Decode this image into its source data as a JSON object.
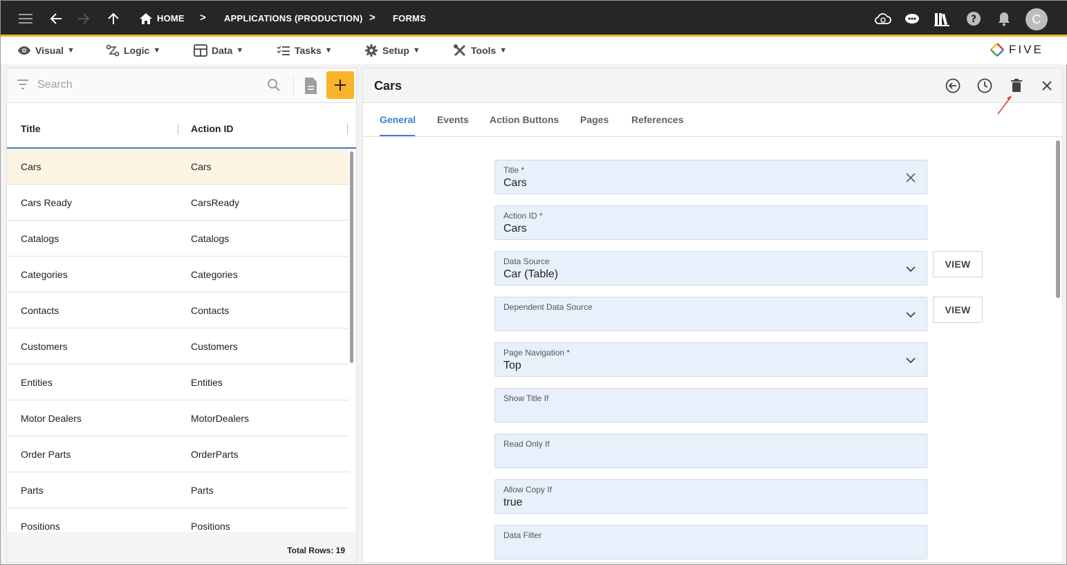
{
  "topbar": {
    "breadcrumbs": [
      "HOME",
      "APPLICATIONS (PRODUCTION)",
      "FORMS"
    ],
    "avatar_initial": "C",
    "icons": [
      "menu-icon",
      "back-arrow-icon",
      "forward-arrow-icon",
      "up-arrow-icon",
      "home-icon",
      "cloud-sync-icon",
      "chat-bot-icon",
      "library-icon",
      "help-icon",
      "bell-icon"
    ]
  },
  "menubar": {
    "items": [
      {
        "label": "Visual",
        "icon": "eye-icon"
      },
      {
        "label": "Logic",
        "icon": "logic-icon"
      },
      {
        "label": "Data",
        "icon": "table-icon"
      },
      {
        "label": "Tasks",
        "icon": "tasks-icon"
      },
      {
        "label": "Setup",
        "icon": "gear-icon"
      },
      {
        "label": "Tools",
        "icon": "tools-icon"
      }
    ],
    "logo_text": "FIVE"
  },
  "list": {
    "search_placeholder": "Search",
    "columns": [
      "Title",
      "Action ID"
    ],
    "rows": [
      {
        "title": "Cars",
        "action_id": "Cars"
      },
      {
        "title": "Cars Ready",
        "action_id": "CarsReady"
      },
      {
        "title": "Catalogs",
        "action_id": "Catalogs"
      },
      {
        "title": "Categories",
        "action_id": "Categories"
      },
      {
        "title": "Contacts",
        "action_id": "Contacts"
      },
      {
        "title": "Customers",
        "action_id": "Customers"
      },
      {
        "title": "Entities",
        "action_id": "Entities"
      },
      {
        "title": "Motor Dealers",
        "action_id": "MotorDealers"
      },
      {
        "title": "Order Parts",
        "action_id": "OrderParts"
      },
      {
        "title": "Parts",
        "action_id": "Parts"
      },
      {
        "title": "Positions",
        "action_id": "Positions"
      }
    ],
    "total_rows": "Total Rows: 19"
  },
  "form": {
    "title": "Cars",
    "tabs": [
      "General",
      "Events",
      "Action Buttons",
      "Pages",
      "References"
    ],
    "fields": {
      "title": {
        "label": "Title *",
        "value": "Cars"
      },
      "action_id": {
        "label": "Action ID *",
        "value": "Cars"
      },
      "data_source": {
        "label": "Data Source",
        "value": "Car (Table)"
      },
      "dependent_data_source": {
        "label": "Dependent Data Source",
        "value": ""
      },
      "page_navigation": {
        "label": "Page Navigation *",
        "value": "Top"
      },
      "show_title_if": {
        "label": "Show Title If",
        "value": ""
      },
      "read_only_if": {
        "label": "Read Only If",
        "value": ""
      },
      "allow_copy_if": {
        "label": "Allow Copy If",
        "value": "true"
      },
      "data_filter": {
        "label": "Data Filter",
        "value": ""
      }
    },
    "view_label": "VIEW"
  },
  "colors": {
    "accent": "#f9b42b",
    "tab_active": "#3b7ecf",
    "field_bg": "#e8f0fb",
    "annotation_arrow": "#e53935"
  }
}
